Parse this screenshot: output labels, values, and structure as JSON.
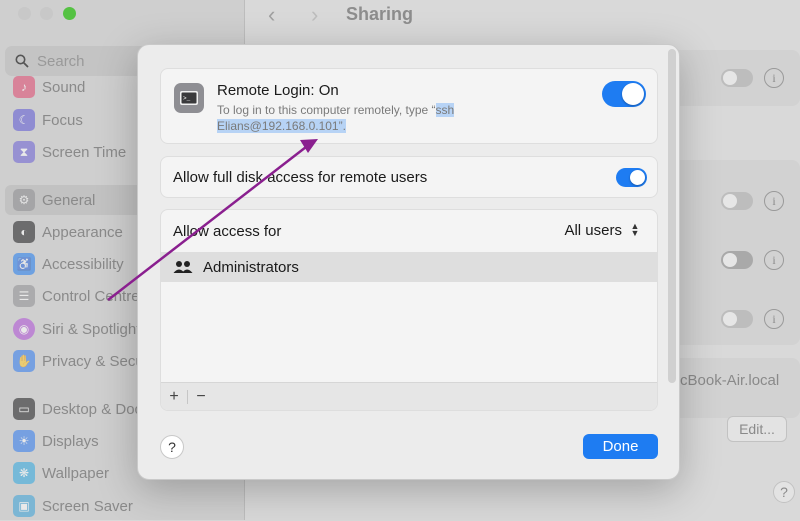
{
  "sidebar": {
    "search_placeholder": "Search",
    "items": [
      {
        "label": "Sound",
        "icon": "sound-icon",
        "color": "#e0456e"
      },
      {
        "label": "Focus",
        "icon": "moon-icon",
        "color": "#5b57d6"
      },
      {
        "label": "Screen Time",
        "icon": "hourglass-icon",
        "color": "#6b5fd6"
      },
      {
        "label": "General",
        "icon": "gear-icon",
        "color": "#8e8e93"
      },
      {
        "label": "Appearance",
        "icon": "appearance-icon",
        "color": "#1c1c1e"
      },
      {
        "label": "Accessibility",
        "icon": "accessibility-icon",
        "color": "#1f7cf0"
      },
      {
        "label": "Control Centre",
        "icon": "control-centre-icon",
        "color": "#8e8e93"
      },
      {
        "label": "Siri & Spotlight",
        "icon": "siri-icon",
        "color": "#b04fd8"
      },
      {
        "label": "Privacy & Security",
        "icon": "hand-icon",
        "color": "#2f7bf0"
      },
      {
        "label": "Desktop & Dock",
        "icon": "dock-icon",
        "color": "#1c1c1e"
      },
      {
        "label": "Displays",
        "icon": "sun-icon",
        "color": "#2f7bf0"
      },
      {
        "label": "Wallpaper",
        "icon": "wallpaper-icon",
        "color": "#2fa8e0"
      },
      {
        "label": "Screen Saver",
        "icon": "screensaver-icon",
        "color": "#3aa2d9"
      }
    ]
  },
  "header": {
    "title": "Sharing"
  },
  "background": {
    "hostname_fragment": "cBook-Air.local",
    "edit_label": "Edit...",
    "help_label": "?"
  },
  "dialog": {
    "remote_login": {
      "title": "Remote Login: On",
      "desc_prefix": "To log in to this computer remotely, type “",
      "desc_selected_1": "ssh",
      "desc_selected_2": "Elians@192.168.0.101”.",
      "enabled": true
    },
    "full_disk": {
      "label": "Allow full disk access for remote users",
      "enabled": true
    },
    "access": {
      "label": "Allow access for",
      "selected": "All users",
      "users": [
        {
          "name": "Administrators",
          "icon": "group-icon"
        }
      ],
      "add_label": "+",
      "remove_label": "−"
    },
    "help_label": "?",
    "done_label": "Done"
  },
  "colors": {
    "accent": "#1e7cf2",
    "annotation_arrow": "#8a1f8f"
  }
}
